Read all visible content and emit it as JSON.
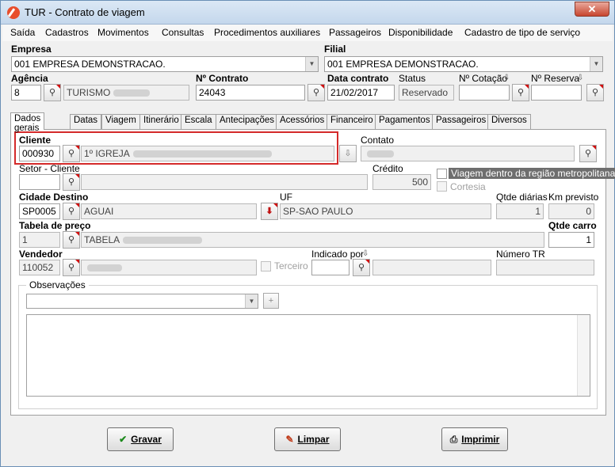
{
  "window": {
    "title": "TUR - Contrato de viagem",
    "close_glyph": "✕"
  },
  "menu": [
    "Saída",
    "Cadastros",
    "Movimentos",
    "Consultas",
    "Procedimentos auxiliares",
    "Passageiros",
    "Disponibilidade",
    "Cadastro de tipo de serviço"
  ],
  "header": {
    "empresa_label": "Empresa",
    "empresa_value": "001 EMPRESA DEMONSTRACAO.",
    "filial_label": "Filial",
    "filial_value": "001 EMPRESA DEMONSTRACAO.",
    "agencia_label": "Agência",
    "agencia_code": "8",
    "agencia_name": "TURISMO",
    "contrato_label": "Nº Contrato",
    "contrato_value": "24043",
    "data_label": "Data contrato",
    "data_value": "21/02/2017",
    "status_label": "Status",
    "status_value": "Reservado",
    "cotacao_label": "Nº Cotação",
    "reserva_label": "Nº Reserva"
  },
  "tabs": [
    "Dados gerais",
    "Datas",
    "Viagem",
    "Itinerário",
    "Escala",
    "Antecipações",
    "Acessórios",
    "Financeiro",
    "Pagamentos",
    "Passageiros",
    "Diversos"
  ],
  "form": {
    "cliente_label": "Cliente",
    "cliente_code": "000930",
    "cliente_name": "1º IGREJA",
    "contato_label": "Contato",
    "setor_label": "Setor - Cliente",
    "credito_label": "Crédito",
    "credito_value": "500",
    "viagem_metro_label": "Viagem dentro da região metropolitana",
    "cortesia_label": "Cortesia",
    "cidade_label": "Cidade Destino",
    "cidade_code": "SP0005",
    "cidade_name": "AGUAI",
    "uf_label": "UF",
    "uf_value": "SP-SAO PAULO",
    "qtde_diarias_label": "Qtde diárias",
    "qtde_diarias_value": "1",
    "km_label": "Km previsto",
    "km_value": "0",
    "tabela_label": "Tabela de preço",
    "tabela_code": "1",
    "tabela_name": "TABELA",
    "qtde_carro_label": "Qtde carro",
    "qtde_carro_value": "1",
    "vendedor_label": "Vendedor",
    "vendedor_code": "110052",
    "terceiro_label": "Terceiro",
    "indicado_label": "Indicado por",
    "numero_tr_label": "Número TR",
    "observacoes_label": "Observações"
  },
  "buttons": {
    "gravar": "Gravar",
    "limpar": "Limpar",
    "imprimir": "Imprimir"
  }
}
